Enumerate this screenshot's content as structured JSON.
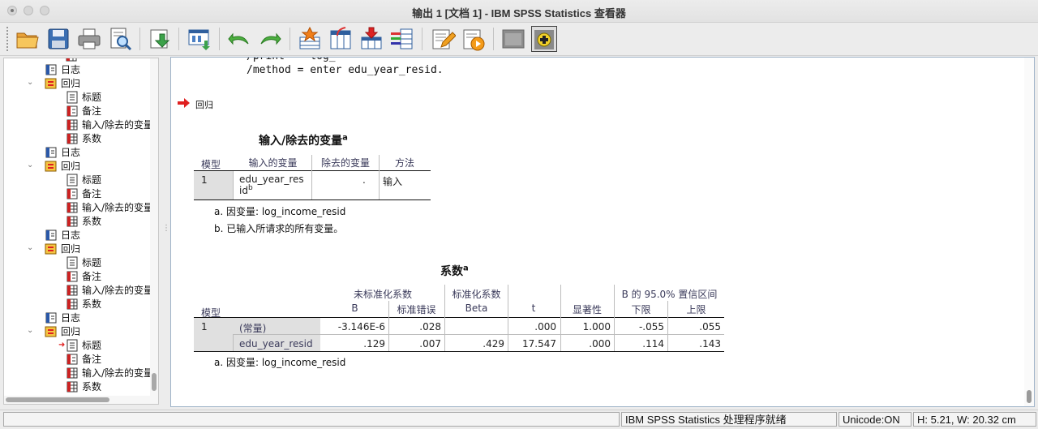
{
  "window": {
    "title": "输出 1 [文档 1] - IBM SPSS Statistics 查看器"
  },
  "toolbar": {
    "buttons": [
      "open-icon",
      "save-icon",
      "print-icon",
      "print-preview-icon",
      "export-icon",
      "goto-data-icon",
      "undo-icon",
      "redo-icon",
      "goto-case-icon",
      "goto-variable-icon",
      "insert-cases-icon",
      "variables-icon",
      "edit-syntax-icon",
      "run-script-icon",
      "designate-window-icon",
      "create-output-icon"
    ]
  },
  "nav": {
    "items": [
      {
        "label": "日志",
        "icon": "log-icon"
      },
      {
        "label": "回归",
        "icon": "regression-icon"
      },
      {
        "label": "标题",
        "icon": "title-icon"
      },
      {
        "label": "备注",
        "icon": "notes-icon"
      },
      {
        "label": "输入/除去的变量",
        "icon": "table-icon"
      },
      {
        "label": "系数",
        "icon": "table-icon"
      },
      {
        "label": "日志",
        "icon": "log-icon"
      },
      {
        "label": "回归",
        "icon": "regression-icon"
      },
      {
        "label": "标题",
        "icon": "title-icon"
      },
      {
        "label": "备注",
        "icon": "notes-icon"
      },
      {
        "label": "输入/除去的变量",
        "icon": "table-icon"
      },
      {
        "label": "系数",
        "icon": "table-icon"
      },
      {
        "label": "日志",
        "icon": "log-icon"
      },
      {
        "label": "回归",
        "icon": "regression-icon"
      },
      {
        "label": "标题",
        "icon": "title-icon"
      },
      {
        "label": "备注",
        "icon": "notes-icon"
      },
      {
        "label": "输入/除去的变量",
        "icon": "table-icon"
      },
      {
        "label": "系数",
        "icon": "table-icon"
      },
      {
        "label": "日志",
        "icon": "log-icon"
      },
      {
        "label": "回归",
        "icon": "regression-icon"
      },
      {
        "label": "标题",
        "icon": "title-icon"
      },
      {
        "label": "备注",
        "icon": "notes-icon"
      },
      {
        "label": "输入/除去的变量",
        "icon": "table-icon"
      },
      {
        "label": "系数",
        "icon": "table-icon"
      }
    ]
  },
  "content": {
    "syntax_line": "/method = enter edu_year_resid.",
    "section_label": "回归",
    "entered_table": {
      "title": "输入/除去的变量",
      "title_sup": "a",
      "headers": [
        "模型",
        "输入的变量",
        "除去的变量",
        "方法"
      ],
      "row": {
        "model": "1",
        "entered_line1": "edu_year_res",
        "entered_line2": "id",
        "entered_sup": "b",
        "removed": ".",
        "method": "输入"
      },
      "footnotes": [
        "a. 因变量:   log_income_resid",
        "b. 已输入所请求的所有变量。"
      ]
    },
    "coef_table": {
      "title": "系数",
      "title_sup": "a",
      "group_headers": [
        "未标准化系数",
        "标准化系数",
        "B 的 95.0% 置信区间"
      ],
      "headers": [
        "模型",
        "B",
        "标准错误",
        "Beta",
        "t",
        "显著性",
        "下限",
        "上限"
      ],
      "model": "1",
      "rows": [
        {
          "name": "(常量)",
          "b": "-3.146E-6",
          "se": ".028",
          "beta": "",
          "t": ".000",
          "sig": "1.000",
          "lower": "-.055",
          "upper": ".055"
        },
        {
          "name": "edu_year_resid",
          "b": ".129",
          "se": ".007",
          "beta": ".429",
          "t": "17.547",
          "sig": ".000",
          "lower": ".114",
          "upper": ".143"
        }
      ],
      "footnote": "a. 因变量:   log_income_resid"
    }
  },
  "status": {
    "processor": "IBM SPSS Statistics 处理程序就绪",
    "unicode": "Unicode:ON",
    "size": "H: 5.21, W: 20.32 cm"
  }
}
